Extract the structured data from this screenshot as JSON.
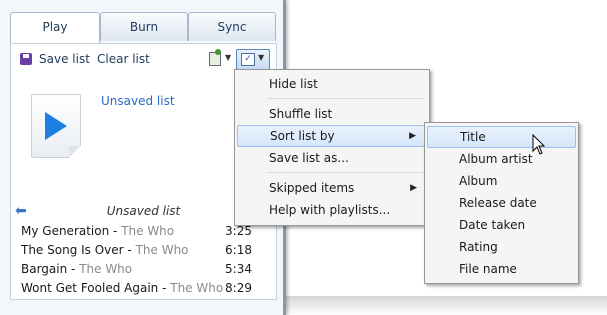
{
  "tabs": [
    {
      "label": "Play",
      "active": true
    },
    {
      "label": "Burn",
      "active": false
    },
    {
      "label": "Sync",
      "active": false
    }
  ],
  "toolbar": {
    "save_label": "Save list",
    "clear_label": "Clear list",
    "play_to_icon": "play-to-icon",
    "list_options_icon": "list-options-icon"
  },
  "album": {
    "art_icon": "play-file-icon",
    "title": "Unsaved list"
  },
  "list": {
    "back_icon": "back-arrow-icon",
    "name": "Unsaved list",
    "tracks": [
      {
        "title": "My Generation",
        "artist": "The Who",
        "duration": "3:25"
      },
      {
        "title": "The Song Is Over",
        "artist": "The Who",
        "duration": "6:18"
      },
      {
        "title": "Bargain",
        "artist": "The Who",
        "duration": "5:34"
      },
      {
        "title": "Wont Get Fooled Again",
        "artist": "The Who",
        "duration": "8:29"
      }
    ]
  },
  "menu": {
    "items": [
      {
        "label": "Hide list"
      },
      {
        "label": "Shuffle list"
      },
      {
        "label": "Sort list by",
        "submenu": true,
        "highlighted": true
      },
      {
        "label": "Save list as..."
      },
      {
        "label": "Skipped items",
        "submenu": true
      },
      {
        "label": "Help with playlists..."
      }
    ]
  },
  "submenu": {
    "items": [
      {
        "label": "Title",
        "highlighted": true
      },
      {
        "label": "Album artist"
      },
      {
        "label": "Album"
      },
      {
        "label": "Release date"
      },
      {
        "label": "Date taken"
      },
      {
        "label": "Rating"
      },
      {
        "label": "File name"
      }
    ]
  },
  "colors": {
    "accent": "#2b68c7",
    "highlight": "#d5e6fb",
    "artist_gray": "#8a8a8a"
  }
}
